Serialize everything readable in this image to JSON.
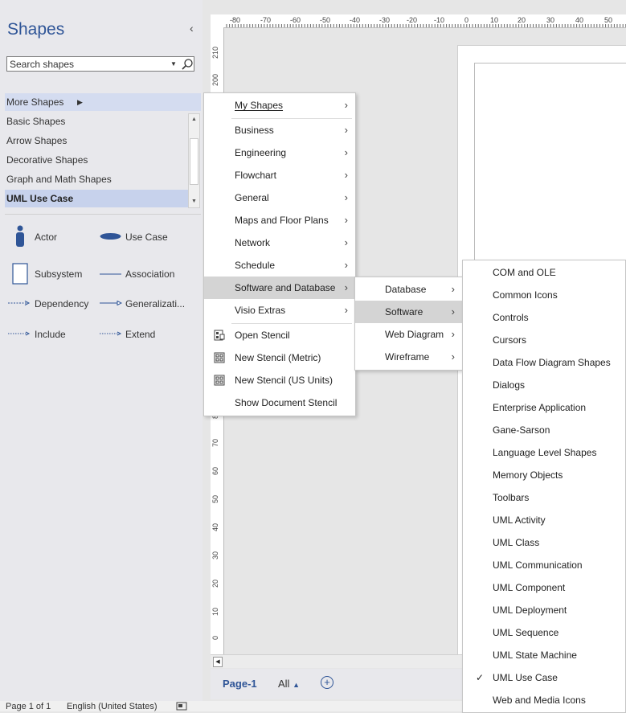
{
  "shapes_pane": {
    "title": "Shapes",
    "collapse_icon": "‹",
    "search_placeholder": "Search shapes",
    "more_shapes": "More Shapes",
    "categories": [
      "Basic Shapes",
      "Arrow Shapes",
      "Decorative Shapes",
      "Graph and Math Shapes",
      "UML Use Case"
    ],
    "stencil_shapes": [
      "Actor",
      "Use Case",
      "Subsystem",
      "Association",
      "Dependency",
      "Generalizati...",
      "Include",
      "Extend"
    ]
  },
  "ruler": {
    "horizontal": [
      "-80",
      "-70",
      "-60",
      "-50",
      "-40",
      "-30",
      "-20",
      "-10",
      "0",
      "10",
      "20",
      "30",
      "40",
      "50"
    ],
    "vertical": [
      "210",
      "200",
      "80",
      "70",
      "60",
      "50",
      "40",
      "30",
      "20",
      "10",
      "0"
    ]
  },
  "menu_more_shapes": {
    "items": [
      "My Shapes",
      "Business",
      "Engineering",
      "Flowchart",
      "General",
      "Maps and Floor Plans",
      "Network",
      "Schedule",
      "Software and Database",
      "Visio Extras",
      "Open Stencil",
      "New Stencil (Metric)",
      "New Stencil (US Units)",
      "Show Document Stencil"
    ]
  },
  "menu_software_db": {
    "items": [
      "Database",
      "Software",
      "Web Diagram",
      "Wireframe"
    ]
  },
  "menu_software": {
    "items": [
      "COM and OLE",
      "Common Icons",
      "Controls",
      "Cursors",
      "Data Flow Diagram Shapes",
      "Dialogs",
      "Enterprise Application",
      "Gane-Sarson",
      "Language Level Shapes",
      "Memory Objects",
      "Toolbars",
      "UML Activity",
      "UML Class",
      "UML Communication",
      "UML Component",
      "UML Deployment",
      "UML Sequence",
      "UML State Machine",
      "UML Use Case",
      "Web and Media Icons"
    ],
    "checked": "UML Use Case"
  },
  "page_tabs": {
    "page1": "Page-1",
    "all": "All",
    "add_icon": "+"
  },
  "status_bar": {
    "page": "Page 1 of 1",
    "language": "English (United States)"
  },
  "colors": {
    "accent": "#2f5597",
    "highlight": "#d4d4d4",
    "selected_category": "#c7d2ec"
  }
}
